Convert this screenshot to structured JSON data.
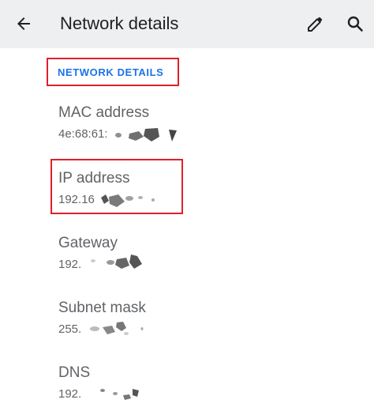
{
  "app_bar": {
    "title": "Network details",
    "back_icon": "arrow-back-icon",
    "edit_icon": "pencil-icon",
    "search_icon": "search-icon",
    "background": "#eeeff0"
  },
  "section": {
    "header": "NETWORK DETAILS",
    "header_color": "#1a73e8",
    "highlight_color": "#e0202a"
  },
  "items": [
    {
      "label": "MAC address",
      "value": "4e:68:61:"
    },
    {
      "label": "IP address",
      "value": "192.16"
    },
    {
      "label": "Gateway",
      "value": "192."
    },
    {
      "label": "Subnet mask",
      "value": "255."
    },
    {
      "label": "DNS",
      "value": "192."
    }
  ]
}
